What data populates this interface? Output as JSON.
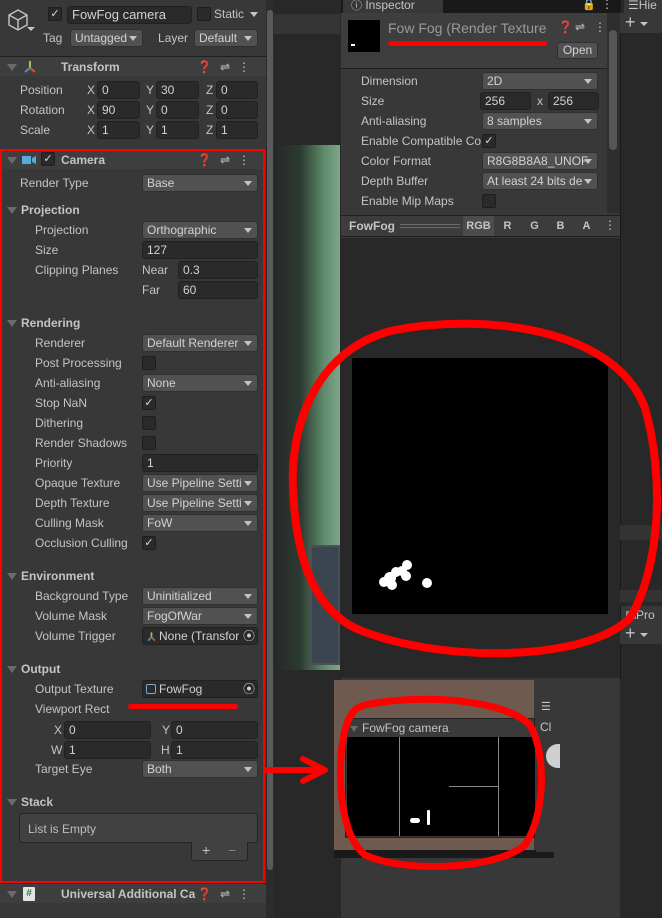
{
  "gameobject": {
    "active": true,
    "name": "FowFog camera",
    "static_label": "Static",
    "tag_label": "Tag",
    "tag_value": "Untagged",
    "layer_label": "Layer",
    "layer_value": "Default"
  },
  "transform": {
    "title": "Transform",
    "rows": [
      {
        "label": "Position",
        "x": "0",
        "y": "30",
        "z": "0"
      },
      {
        "label": "Rotation",
        "x": "90",
        "y": "0",
        "z": "0"
      },
      {
        "label": "Scale",
        "x": "1",
        "y": "1",
        "z": "1"
      }
    ],
    "axis": {
      "x": "X",
      "y": "Y",
      "z": "Z"
    }
  },
  "camera": {
    "title": "Camera",
    "enabled": true,
    "render_type_label": "Render Type",
    "render_type_value": "Base",
    "projection": {
      "title": "Projection",
      "projection_label": "Projection",
      "projection_value": "Orthographic",
      "size_label": "Size",
      "size_value": "127",
      "clipping_label": "Clipping Planes",
      "near_label": "Near",
      "near_value": "0.3",
      "far_label": "Far",
      "far_value": "60"
    },
    "rendering": {
      "title": "Rendering",
      "renderer_label": "Renderer",
      "renderer_value": "Default Renderer",
      "post_processing_label": "Post Processing",
      "post_processing": false,
      "anti_aliasing_label": "Anti-aliasing",
      "anti_aliasing_value": "None",
      "stop_nan_label": "Stop NaN",
      "stop_nan": true,
      "dithering_label": "Dithering",
      "dithering": false,
      "render_shadows_label": "Render Shadows",
      "render_shadows": false,
      "priority_label": "Priority",
      "priority_value": "1",
      "opaque_texture_label": "Opaque Texture",
      "opaque_texture_value": "Use Pipeline Setti",
      "depth_texture_label": "Depth Texture",
      "depth_texture_value": "Use Pipeline Setti",
      "culling_mask_label": "Culling Mask",
      "culling_mask_value": "FoW",
      "occlusion_culling_label": "Occlusion Culling",
      "occlusion_culling": true
    },
    "environment": {
      "title": "Environment",
      "background_type_label": "Background Type",
      "background_type_value": "Uninitialized",
      "volume_mask_label": "Volume Mask",
      "volume_mask_value": "FogOfWar",
      "volume_trigger_label": "Volume Trigger",
      "volume_trigger_value": "None (Transfor"
    },
    "output": {
      "title": "Output",
      "output_texture_label": "Output Texture",
      "output_texture_value": "FowFog",
      "viewport_label": "Viewport Rect",
      "x_label": "X",
      "x_value": "0",
      "y_label": "Y",
      "y_value": "0",
      "w_label": "W",
      "w_value": "1",
      "h_label": "H",
      "h_value": "1",
      "target_eye_label": "Target Eye",
      "target_eye_value": "Both"
    },
    "stack": {
      "title": "Stack",
      "empty_text": "List is Empty",
      "add": "+",
      "remove": "−"
    }
  },
  "next_component": {
    "title": "Universal Additional Ca"
  },
  "inspector": {
    "tab_label": "Inspector",
    "asset_title": "Fow Fog (Render Texture",
    "open_button": "Open",
    "dimension_label": "Dimension",
    "dimension_value": "2D",
    "size_label": "Size",
    "size_w": "256",
    "size_x": "x",
    "size_h": "256",
    "aa_label": "Anti-aliasing",
    "aa_value": "8 samples",
    "compat_label": "Enable Compatible Co",
    "compat": true,
    "color_format_label": "Color Format",
    "color_format_value": "R8G8B8A8_UNOF",
    "depth_buffer_label": "Depth Buffer",
    "depth_buffer_value": "At least 24 bits de",
    "mip_label": "Enable Mip Maps",
    "mip": false,
    "preview_name": "FowFog",
    "channels": [
      "RGB",
      "R",
      "G",
      "B",
      "A"
    ]
  },
  "hierarchy": {
    "tab_label": "Hie",
    "add": "+"
  },
  "project": {
    "tab_label": "Pro",
    "add": "+"
  },
  "game_view": {
    "camera_preview_title": "FowFog camera",
    "side_label": "Cl"
  }
}
